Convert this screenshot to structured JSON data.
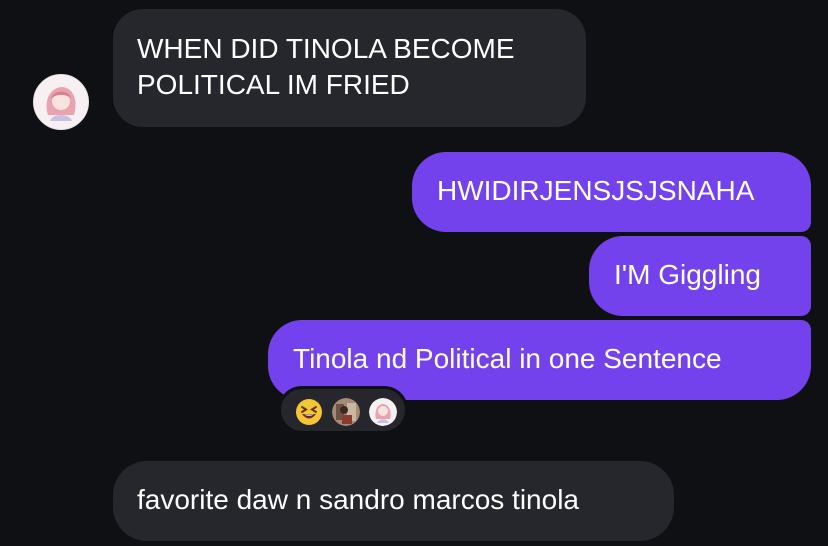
{
  "conversation": {
    "messages": [
      {
        "sender": "other",
        "lines": [
          "WHEN DID TINOLA BECOME",
          "POLITICAL IM FRIED"
        ]
      },
      {
        "sender": "me",
        "text": "HWIDIRJENSJSJSNAHA"
      },
      {
        "sender": "me",
        "text": "I'M Giggling"
      },
      {
        "sender": "me",
        "text": "Tinola nd Political in one Sentence",
        "reactions": [
          "laughing-emoji",
          "user-avatar",
          "user-avatar"
        ]
      },
      {
        "sender": "other",
        "text": "favorite daw n sandro marcos tinola"
      }
    ]
  },
  "colors": {
    "background": "#0f1013",
    "incoming_bubble": "#26272c",
    "outgoing_bubble": "#7442ec",
    "text": "#ffffff"
  }
}
